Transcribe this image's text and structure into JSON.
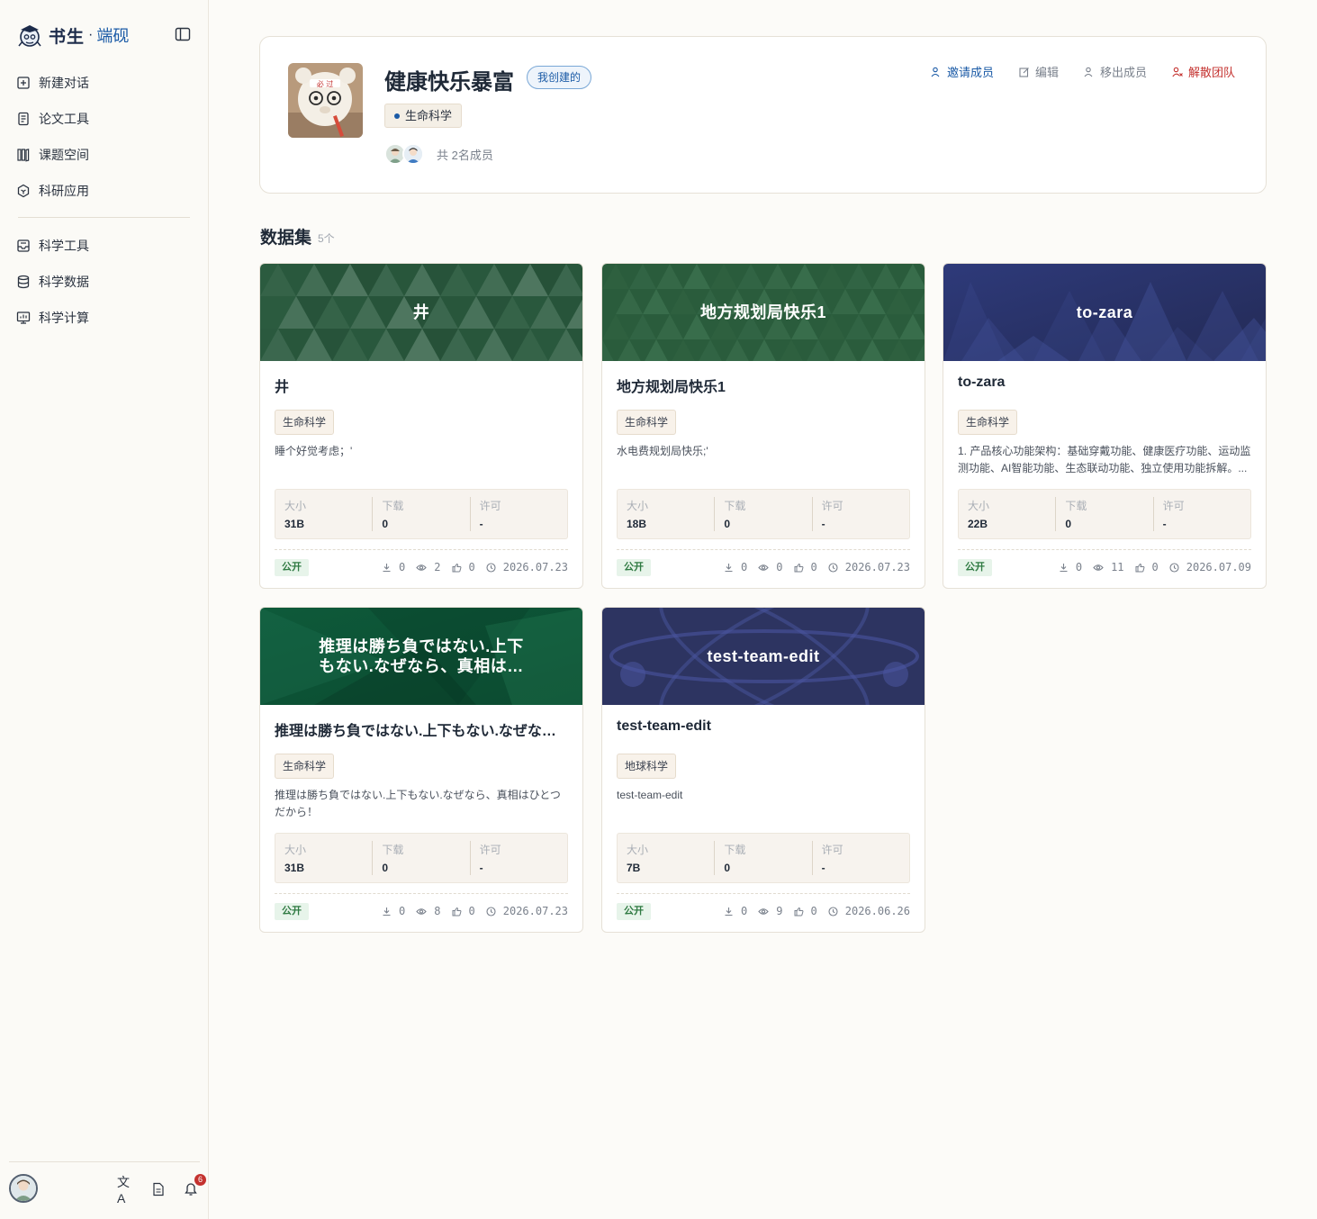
{
  "app": {
    "brand_main": "书生",
    "brand_dot": "·",
    "brand_sub": "端砚"
  },
  "sidebar": {
    "group1": [
      {
        "label": "新建对话",
        "icon": "plus-square-icon"
      },
      {
        "label": "论文工具",
        "icon": "document-icon"
      },
      {
        "label": "课题空间",
        "icon": "books-icon"
      },
      {
        "label": "科研应用",
        "icon": "hexagon-icon"
      }
    ],
    "group2": [
      {
        "label": "科学工具",
        "icon": "inbox-tool-icon"
      },
      {
        "label": "科学数据",
        "icon": "database-icon"
      },
      {
        "label": "科学计算",
        "icon": "monitor-chart-icon"
      }
    ],
    "notification_count": "6",
    "lang_label": "文A"
  },
  "team": {
    "name": "健康快乐暴富",
    "badge": "我创建的",
    "tag": "生命科学",
    "member_count": "共 2名成员",
    "actions": {
      "invite": "邀请成员",
      "edit": "编辑",
      "remove": "移出成员",
      "dissolve": "解散团队"
    }
  },
  "datasets_section": {
    "title": "数据集",
    "count": "5个"
  },
  "stat_labels": {
    "size": "大小",
    "downloads": "下载",
    "license": "许可"
  },
  "datasets": [
    {
      "banner": "井",
      "name": "井",
      "tag": "生命科学",
      "desc": "睡个好觉考虑；'",
      "size": "31B",
      "downloads": "0",
      "license": "-",
      "visibility": "公开",
      "dl": "0",
      "views": "2",
      "likes": "0",
      "date": "2026.07.23",
      "theme": "green-tri"
    },
    {
      "banner": "地方规划局快乐1",
      "name": "地方规划局快乐1",
      "tag": "生命科学",
      "desc": "水电费规划局快乐;'",
      "size": "18B",
      "downloads": "0",
      "license": "-",
      "visibility": "公开",
      "dl": "0",
      "views": "0",
      "likes": "0",
      "date": "2026.07.23",
      "theme": "green-tri2"
    },
    {
      "banner": "to-zara",
      "name": "to-zara",
      "tag": "生命科学",
      "desc": "1. 产品核心功能架构：基础穿戴功能、健康医疗功能、运动监测功能、AI智能功能、生态联动功能、独立使用功能拆解。...",
      "size": "22B",
      "downloads": "0",
      "license": "-",
      "visibility": "公开",
      "dl": "0",
      "views": "11",
      "likes": "0",
      "date": "2026.07.09",
      "theme": "navy-peaks"
    },
    {
      "banner": "推理は勝ち負ではない.上下もない.なぜなら、真相はひとつだから！",
      "name": "推理は勝ち負ではない.上下もない.なぜなら、真相はひとつだから！",
      "tag": "生命科学",
      "desc": "推理は勝ち負ではない.上下もない.なぜなら、真相はひとつだから！",
      "size": "31B",
      "downloads": "0",
      "license": "-",
      "visibility": "公开",
      "dl": "0",
      "views": "8",
      "likes": "0",
      "date": "2026.07.23",
      "theme": "green-shards"
    },
    {
      "banner": "test-team-edit",
      "name": "test-team-edit",
      "tag": "地球科学",
      "desc": "test-team-edit",
      "size": "7B",
      "downloads": "0",
      "license": "-",
      "visibility": "公开",
      "dl": "0",
      "views": "9",
      "likes": "0",
      "date": "2026.06.26",
      "theme": "navy-atom"
    }
  ],
  "colors": {
    "accent": "#1a5aa6",
    "danger": "#c4322f",
    "public_badge": "#2f7a42",
    "green_banner": "#2b5b3f",
    "navy_banner": "#2a3366"
  }
}
